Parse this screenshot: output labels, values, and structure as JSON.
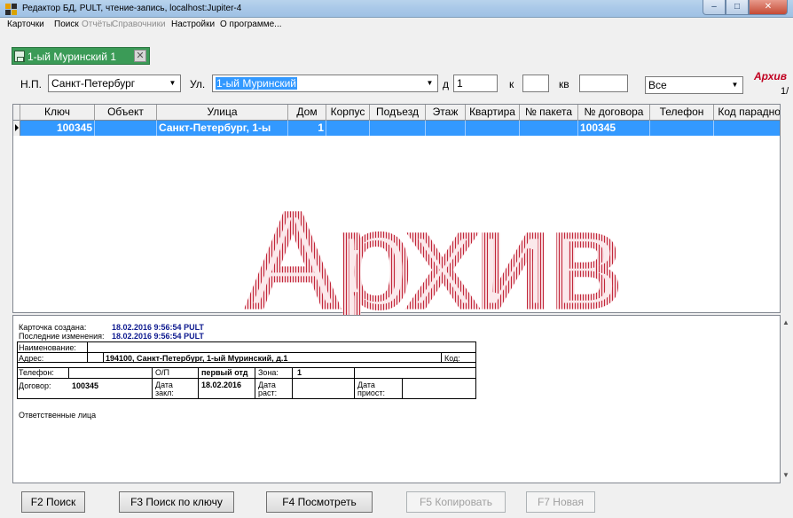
{
  "window": {
    "title": "Редактор БД, PULT, чтение-запись, localhost:Jupiter-4",
    "controls": [
      "–",
      "□",
      "✕"
    ]
  },
  "menu": {
    "items": [
      {
        "label": "Карточки",
        "enabled": true
      },
      {
        "label": "Поиск",
        "enabled": true
      },
      {
        "label": "Отчёты",
        "enabled": false
      },
      {
        "label": "Справочники",
        "enabled": false
      },
      {
        "label": "Настройки",
        "enabled": true
      },
      {
        "label": "О программе...",
        "enabled": true
      }
    ]
  },
  "tab": {
    "label": "1-ый Муринский 1",
    "close": "✕"
  },
  "filters": {
    "city_label": "Н.П.",
    "city_value": "Санкт-Петербург",
    "street_label": "Ул.",
    "street_value": "1-ый Муринский",
    "house_label": "д",
    "house_value": "1",
    "building_label": "к",
    "building_value": "",
    "apt_label": "кв",
    "apt_value": "",
    "status_value": "Все",
    "archive_label": "Архив",
    "page_info": "1/"
  },
  "grid": {
    "columns": [
      "Ключ",
      "Объект",
      "Улица",
      "Дом",
      "Корпус",
      "Подъезд",
      "Этаж",
      "Квартира",
      "№ пакета",
      "№ договора",
      "Телефон",
      "Код парадной"
    ],
    "rows": [
      [
        "100345",
        "",
        "Санкт-Петербург, 1-ы",
        "1",
        "",
        "",
        "",
        "",
        "",
        "100345",
        "",
        ""
      ]
    ],
    "watermark": "Архив"
  },
  "card": {
    "created_label": "Карточка создана:",
    "created_value": "18.02.2016 9:56:54 PULT",
    "modified_label": "Последние изменения:",
    "modified_value": "18.02.2016 9:56:54 PULT",
    "name_label": "Наименование:",
    "address_label": "Адрес:",
    "address_value": "194100, Санкт-Петербург, 1-ый Муринский, д.1",
    "code_label": "Код:",
    "phone_label": "Телефон:",
    "op_label": "О/П",
    "op_value": "первый отд",
    "zone_label": "Зона:",
    "zone_value": "1",
    "contract_label": "Договор:",
    "contract_value": "100345",
    "date_signed_label_1": "Дата",
    "date_signed_label_2": "закл:",
    "date_signed_value": "18.02.2016",
    "date_term_label_1": "Дата",
    "date_term_label_2": "раст:",
    "date_susp_label_1": "Дата",
    "date_susp_label_2": "приост:",
    "responsible_label": "Ответственные лица"
  },
  "buttons": [
    {
      "label": "F2 Поиск",
      "enabled": true
    },
    {
      "label": "F3 Поиск по ключу",
      "enabled": true
    },
    {
      "label": "F4 Посмотреть",
      "enabled": true
    },
    {
      "label": "F5 Копировать",
      "enabled": false
    },
    {
      "label": "F7 Новая",
      "enabled": false
    }
  ],
  "colors": {
    "selection": "#3399ff",
    "tab": "#3b9b57",
    "watermark": "#c2273a",
    "archive": "#c00020",
    "card_blue": "#0e1a8f"
  }
}
